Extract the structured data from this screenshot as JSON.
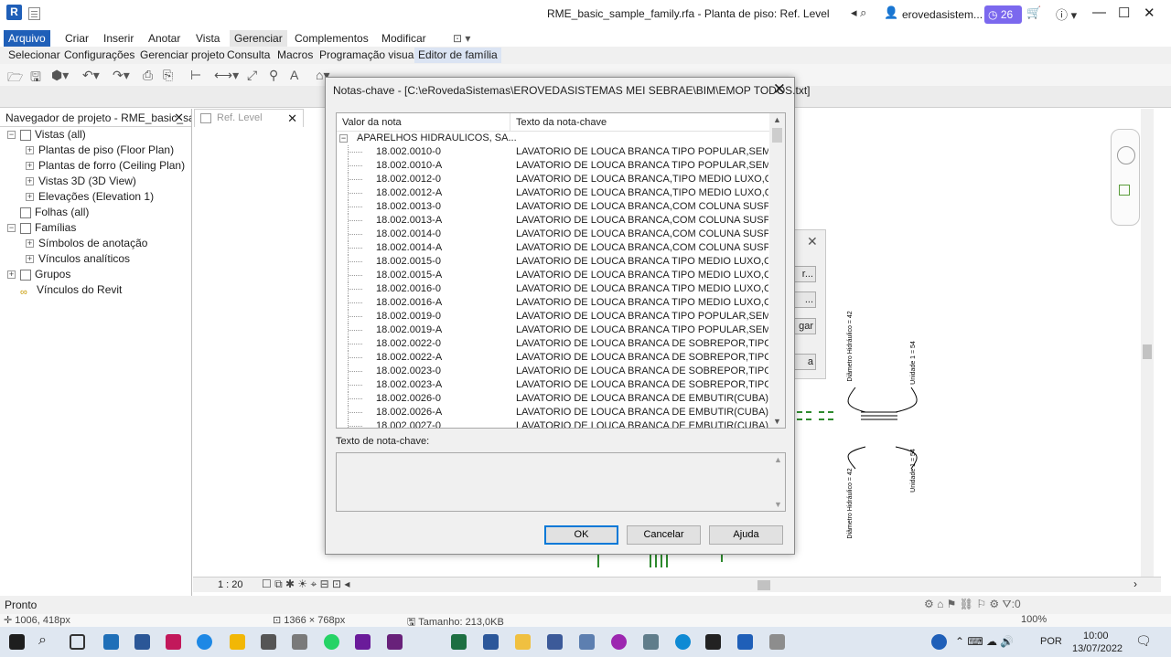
{
  "window": {
    "title": "RME_basic_sample_family.rfa - Planta de piso: Ref. Level",
    "user": "erovedasistem...",
    "notification_count": "26"
  },
  "ribbon": {
    "tabs": [
      "Arquivo",
      "Criar",
      "Inserir",
      "Anotar",
      "Vista",
      "Gerenciar",
      "Complementos",
      "Modificar"
    ],
    "submenu": [
      "Selecionar",
      "Configurações",
      "Gerenciar projeto",
      "Consulta",
      "Macros",
      "Programação visual",
      "Editor de família"
    ]
  },
  "project_browser": {
    "title": "Navegador de projeto - RME_basic_sa...",
    "close": "✕",
    "items": [
      {
        "label": "Vistas (all)",
        "level": 0,
        "expander": "−"
      },
      {
        "label": "Plantas de piso (Floor Plan)",
        "level": 1,
        "expander": "+"
      },
      {
        "label": "Plantas de forro (Ceiling Plan)",
        "level": 1,
        "expander": "+"
      },
      {
        "label": "Vistas 3D (3D View)",
        "level": 1,
        "expander": "+"
      },
      {
        "label": "Elevações (Elevation 1)",
        "level": 1,
        "expander": "+"
      },
      {
        "label": "Folhas (all)",
        "level": 0,
        "expander": ""
      },
      {
        "label": "Famílias",
        "level": 0,
        "expander": "−"
      },
      {
        "label": "Símbolos de anotação",
        "level": 1,
        "expander": "+"
      },
      {
        "label": "Vínculos analíticos",
        "level": 1,
        "expander": "+"
      },
      {
        "label": "Grupos",
        "level": 0,
        "expander": "+"
      },
      {
        "label": "Vínculos do Revit",
        "level": 0,
        "expander": ""
      }
    ]
  },
  "view_tab": {
    "label": "Ref. Level",
    "close": "✕"
  },
  "view_controls": {
    "scale": "1 : 20"
  },
  "dialog": {
    "title": "Notas-chave - [C:\\eRovedaSistemas\\EROVEDASISTEMAS MEI SEBRAE\\BIM\\EMOP TODOS.txt]",
    "close": "✕",
    "col_value": "Valor da nota",
    "col_text": "Texto da nota-chave",
    "group": "APARELHOS HIDRAULICOS, SA...",
    "rows": [
      {
        "value": "18.002.0010-0",
        "text": "LAVATORIO DE LOUCA BRANCA TIPO POPULAR,SEM L..."
      },
      {
        "value": "18.002.0010-A",
        "text": "LAVATORIO DE LOUCA BRANCA TIPO POPULAR,SEM L..."
      },
      {
        "value": "18.002.0012-0",
        "text": "LAVATORIO DE LOUCA BRANCA,TIPO MEDIO LUXO,CO..."
      },
      {
        "value": "18.002.0012-A",
        "text": "LAVATORIO DE LOUCA BRANCA,TIPO MEDIO LUXO,CO..."
      },
      {
        "value": "18.002.0013-0",
        "text": "LAVATORIO DE LOUCA BRANCA,COM COLUNA SUSPE..."
      },
      {
        "value": "18.002.0013-A",
        "text": "LAVATORIO DE LOUCA BRANCA,COM COLUNA SUSPE..."
      },
      {
        "value": "18.002.0014-0",
        "text": "LAVATORIO DE LOUCA BRANCA,COM COLUNA SUSPE..."
      },
      {
        "value": "18.002.0014-A",
        "text": "LAVATORIO DE LOUCA BRANCA,COM COLUNA SUSPE..."
      },
      {
        "value": "18.002.0015-0",
        "text": "LAVATORIO DE LOUCA BRANCA TIPO MEDIO LUXO,CO..."
      },
      {
        "value": "18.002.0015-A",
        "text": "LAVATORIO DE LOUCA BRANCA TIPO MEDIO LUXO,CO..."
      },
      {
        "value": "18.002.0016-0",
        "text": "LAVATORIO DE LOUCA BRANCA TIPO MEDIO LUXO,CO..."
      },
      {
        "value": "18.002.0016-A",
        "text": "LAVATORIO DE LOUCA BRANCA TIPO MEDIO LUXO,CO..."
      },
      {
        "value": "18.002.0019-0",
        "text": "LAVATORIO DE LOUCA BRANCA TIPO POPULAR,SEM L..."
      },
      {
        "value": "18.002.0019-A",
        "text": "LAVATORIO DE LOUCA BRANCA TIPO POPULAR,SEM L..."
      },
      {
        "value": "18.002.0022-0",
        "text": "LAVATORIO DE LOUCA BRANCA DE SOBREPOR,TIPO ..."
      },
      {
        "value": "18.002.0022-A",
        "text": "LAVATORIO DE LOUCA BRANCA DE SOBREPOR,TIPO ..."
      },
      {
        "value": "18.002.0023-0",
        "text": "LAVATORIO DE LOUCA BRANCA DE SOBREPOR,TIPO ..."
      },
      {
        "value": "18.002.0023-A",
        "text": "LAVATORIO DE LOUCA BRANCA DE SOBREPOR,TIPO ..."
      },
      {
        "value": "18.002.0026-0",
        "text": "LAVATORIO DE LOUCA BRANCA DE EMBUTIR(CUBA),TI..."
      },
      {
        "value": "18.002.0026-A",
        "text": "LAVATORIO DE LOUCA BRANCA DE EMBUTIR(CUBA),TI..."
      },
      {
        "value": "18.002.0027-0",
        "text": "LAVATORIO DE LOUCA BRANCA DE EMBUTIR(CUBA),TI..."
      }
    ],
    "text_label": "Texto de nota-chave:",
    "text_value": "",
    "ok": "OK",
    "cancel": "Cancelar",
    "help": "Ajuda"
  },
  "background_dialog": {
    "close": "✕",
    "buttons": [
      "r...",
      "...",
      "gar",
      "a"
    ]
  },
  "drawing_labels": {
    "left_top": "Diâmetro Hidráulico = 42",
    "left_bottom": "Diâmetro Hidráulico = 42",
    "right_top": "Unidade 1 = 54",
    "right_bottom": "Unidade 1 = 54"
  },
  "status": {
    "text": "Pronto",
    "filter_count": ":0"
  },
  "photo_strip": {
    "cursor": "1006, 418px",
    "dimensions": "1366 × 768px",
    "size": "Tamanho: 213,0KB",
    "zoom": "100%"
  },
  "tray": {
    "language": "POR",
    "time": "10:00",
    "date": "13/07/2022"
  },
  "colors": {
    "accent": "#1f5fb8",
    "ok_border": "#0078d7",
    "badge": "#7b68ee"
  }
}
